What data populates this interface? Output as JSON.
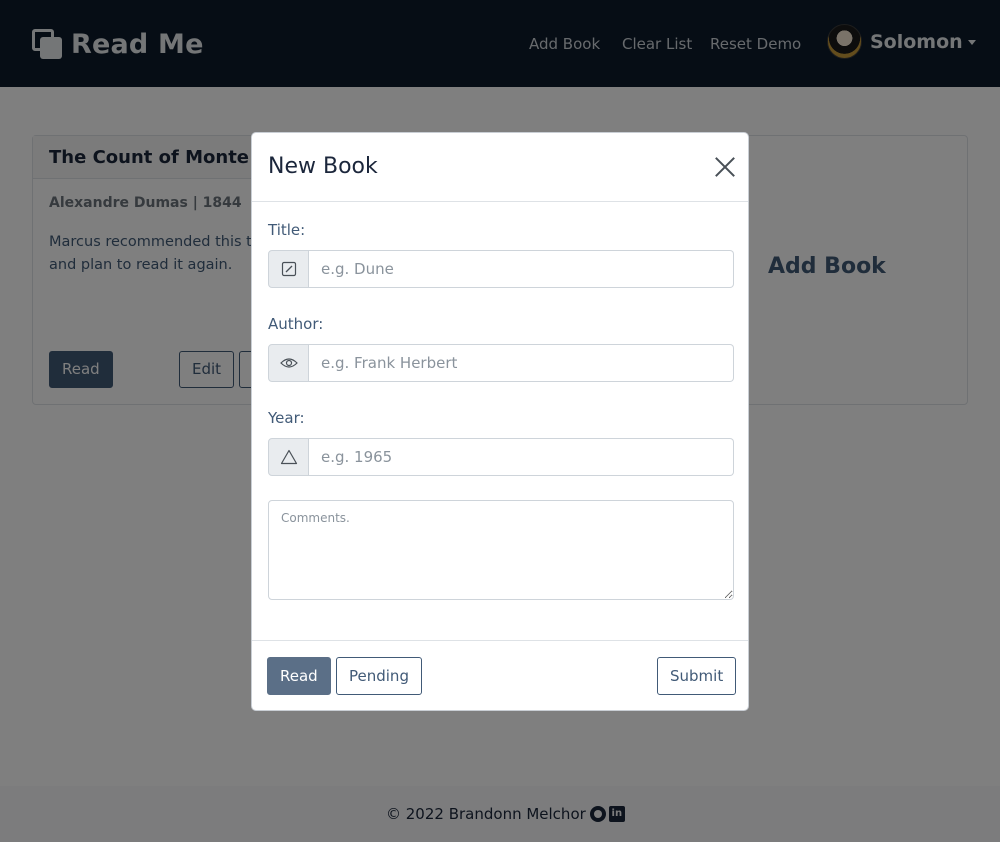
{
  "navbar": {
    "brand": "Read Me",
    "links": {
      "add_book": "Add Book",
      "clear_list": "Clear List",
      "reset_demo": "Reset Demo"
    },
    "user": "Solomon",
    "background": "#0d1b2a"
  },
  "book_card": {
    "title": "The Count of Monte Cristo",
    "meta": "Alexandre Dumas | 1844",
    "comment": "Marcus recommended this to me and I really enjoyed it and plan to read it again.",
    "read_label": "Read",
    "edit_label": "Edit",
    "delete_label": ""
  },
  "add_card": {
    "label": "Add Book"
  },
  "footer": {
    "text": "© 2022 Brandonn Melchor"
  },
  "modal": {
    "title": "New Book",
    "fields": {
      "title": {
        "label": "Title:",
        "placeholder": "e.g. Dune",
        "icon": "pencil-square-icon"
      },
      "author": {
        "label": "Author:",
        "placeholder": "e.g. Frank Herbert",
        "icon": "eye-icon"
      },
      "year": {
        "label": "Year:",
        "placeholder": "e.g. 1965",
        "icon": "triangle-icon"
      },
      "comments": {
        "placeholder": "Comments."
      }
    },
    "buttons": {
      "read": "Read",
      "pending": "Pending",
      "submit": "Submit"
    }
  },
  "colors": {
    "accent": "#415a77",
    "dark": "#1b263b",
    "active_button": "#5b6f87"
  }
}
